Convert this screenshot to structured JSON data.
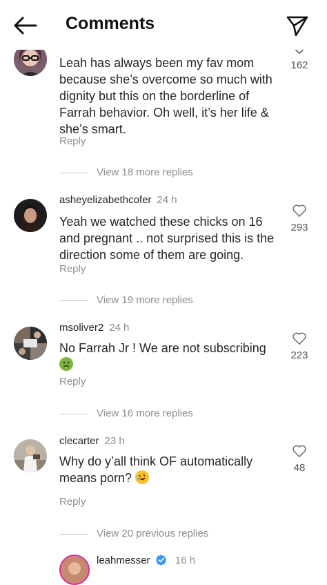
{
  "header": {
    "title": "Comments"
  },
  "comments": [
    {
      "text": "Leah has always been my fav mom because she’s overcome so much with dignity but this on the borderline of Farrah behavior. Oh well, it’s her life & she’s smart.",
      "reply_label": "Reply",
      "likes": "162",
      "view_replies": "View 18 more replies"
    },
    {
      "username": "asheyelizabethcofer",
      "time": "24 h",
      "text": "Yeah we watched these chicks on 16 and pregnant .. not surprised this is the direction some of them are going.",
      "reply_label": "Reply",
      "likes": "293",
      "view_replies": "View 19 more replies"
    },
    {
      "username": "msoliver2",
      "time": "24 h",
      "text": "No Farrah Jr ! We are not subscribing",
      "emoji": "nauseated-face-emoji",
      "reply_label": "Reply",
      "likes": "223",
      "view_replies": "View 16 more replies"
    },
    {
      "username": "clecarter",
      "time": "23 h",
      "text": "Why do y’all think OF automatically means porn?",
      "emoji": "rolling-on-floor-laughing-emoji",
      "reply_label": "Reply",
      "likes": "48",
      "view_replies": "View 20 previous replies"
    },
    {
      "username": "leahmesser",
      "time": "16 h",
      "verified": true
    }
  ],
  "colors": {
    "text": "#262626",
    "secondary": "#8e8e8e",
    "verified": "#3897f0"
  }
}
